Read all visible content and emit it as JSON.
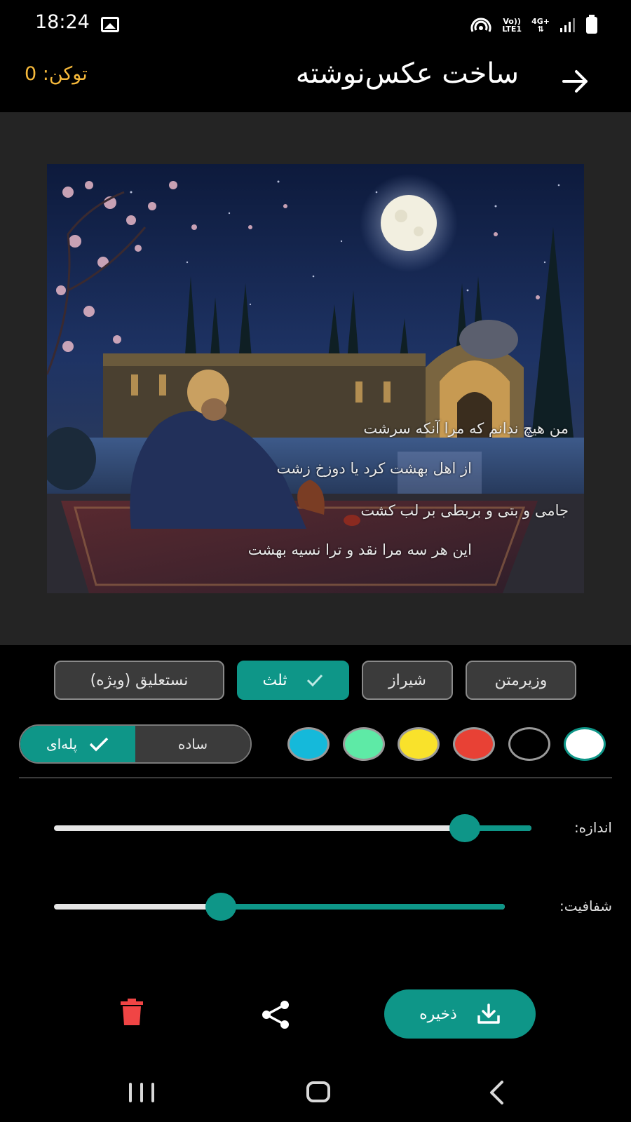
{
  "status_bar": {
    "time": "18:24",
    "volte_top": "Vo))",
    "volte_bottom": "LTE1",
    "network_type": "4G+"
  },
  "app_bar": {
    "title": "ساخت عکس‌نوشته",
    "token_label": "توکن: 0"
  },
  "preview": {
    "poem_lines": [
      "من هیچ ندانم که مرا آنکه سرشت",
      "از اهل بهشت کرد یا دوزخ زشت",
      "جامی و بتی و بربطی بر لب کشت",
      "این هر سه مرا نقد و ترا نسیه بهشت"
    ]
  },
  "fonts": {
    "options": [
      {
        "label": "وزیرمتن",
        "selected": false
      },
      {
        "label": "شیراز",
        "selected": false
      },
      {
        "label": "ثلث",
        "selected": true
      },
      {
        "label": "نستعلیق (ویژه)",
        "selected": false
      }
    ]
  },
  "colors": {
    "swatches": [
      {
        "name": "white",
        "hex": "#ffffff",
        "selected": true
      },
      {
        "name": "black",
        "hex": "#000000",
        "selected": false
      },
      {
        "name": "red",
        "hex": "#e84135",
        "selected": false
      },
      {
        "name": "yellow",
        "hex": "#f9e22b",
        "selected": false
      },
      {
        "name": "green",
        "hex": "#5eeaa6",
        "selected": false
      },
      {
        "name": "cyan",
        "hex": "#15b9da",
        "selected": false
      }
    ]
  },
  "style_toggle": {
    "stepped_label": "پله‌ای",
    "plain_label": "ساده",
    "selected": "stepped"
  },
  "sliders": {
    "size": {
      "label": "اندازه:",
      "value": 0.14
    },
    "opacity": {
      "label": "شفافیت:",
      "value": 0.63
    }
  },
  "actions": {
    "save_label": "ذخیره"
  },
  "theme": {
    "accent": "#0e9688",
    "token_color": "#f6b93b",
    "delete_color": "#f04545"
  }
}
